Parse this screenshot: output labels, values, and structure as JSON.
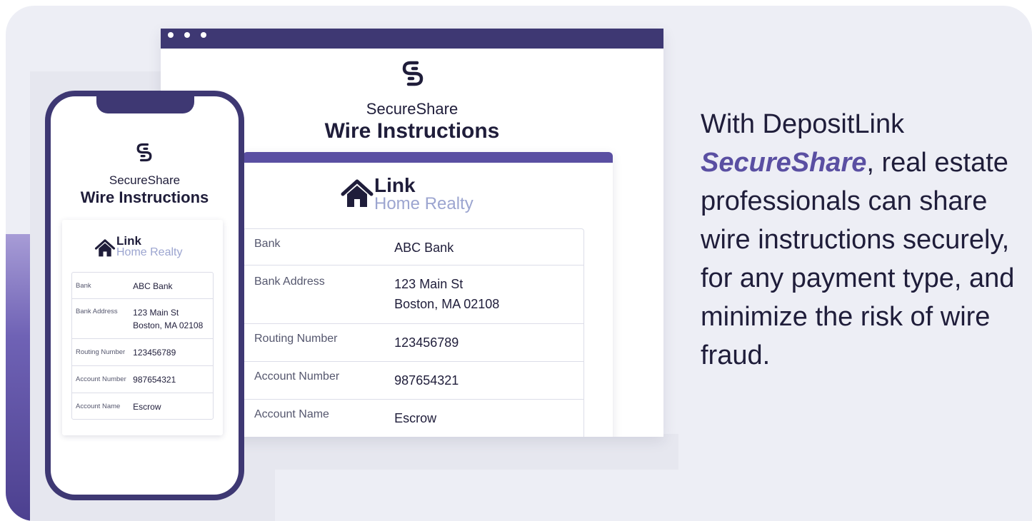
{
  "desktop": {
    "brand": "SecureShare",
    "title": "Wire Instructions",
    "company": {
      "name": "Link",
      "sub": "Home Realty"
    },
    "rows": [
      {
        "label": "Bank",
        "value_line1": "ABC Bank",
        "value_line2": ""
      },
      {
        "label": "Bank Address",
        "value_line1": "123 Main St",
        "value_line2": "Boston, MA 02108"
      },
      {
        "label": "Routing Number",
        "value_line1": "123456789",
        "value_line2": ""
      },
      {
        "label": "Account Number",
        "value_line1": "987654321",
        "value_line2": ""
      },
      {
        "label": "Account Name",
        "value_line1": "Escrow",
        "value_line2": ""
      }
    ]
  },
  "phone": {
    "brand": "SecureShare",
    "title": "Wire Instructions",
    "company": {
      "name": "Link",
      "sub": "Home Realty"
    },
    "rows": [
      {
        "label": "Bank",
        "value_line1": "ABC Bank",
        "value_line2": ""
      },
      {
        "label": "Bank Address",
        "value_line1": "123 Main St",
        "value_line2": "Boston, MA 02108"
      },
      {
        "label": "Routing Number",
        "value_line1": "123456789",
        "value_line2": ""
      },
      {
        "label": "Account Number",
        "value_line1": "987654321",
        "value_line2": ""
      },
      {
        "label": "Account Name",
        "value_line1": "Escrow",
        "value_line2": ""
      }
    ]
  },
  "copy": {
    "prefix": "With DepositLink",
    "highlight": "SecureShare",
    "suffix": ", real estate professionals can share wire instructions securely, for any payment type, and minimize the risk of wire fraud."
  },
  "icons": {
    "logo": "secureshare-logo-icon",
    "house": "house-icon",
    "window_dots": "window-dots-icon"
  },
  "colors": {
    "accent": "#5a4fa2",
    "frame": "#3e3873",
    "muted_text": "#9ca5d0",
    "background": "#edeef5"
  }
}
